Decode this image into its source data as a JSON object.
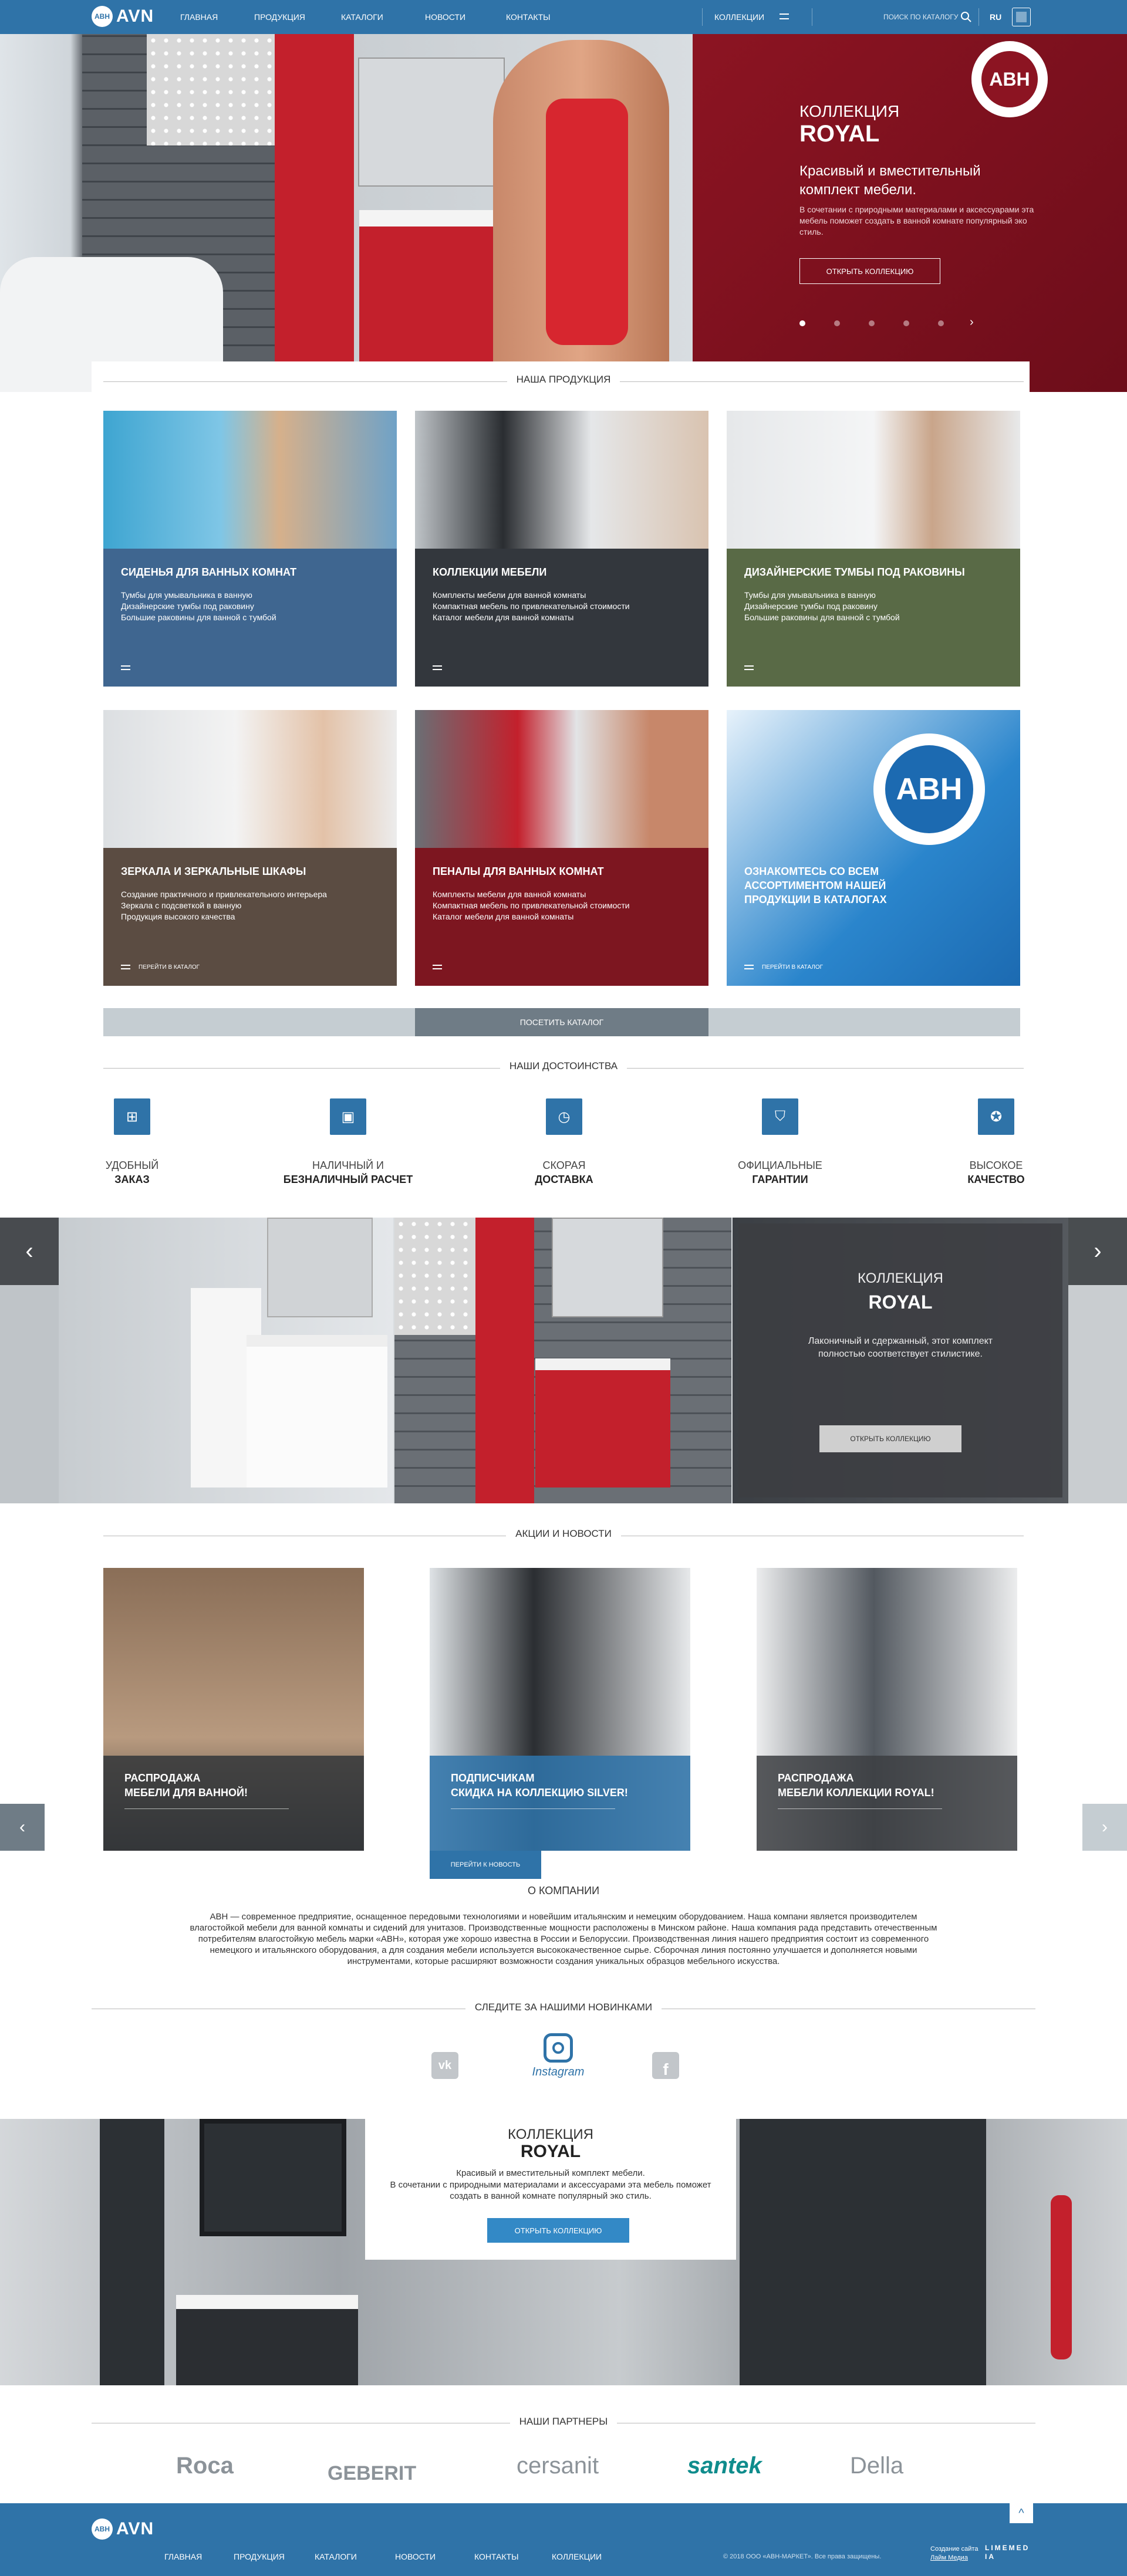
{
  "header": {
    "logo_badge": "АВН",
    "logo_text": "AVN",
    "nav": [
      "ГЛАВНАЯ",
      "ПРОДУКЦИЯ",
      "КАТАЛОГИ",
      "НОВОСТИ",
      "КОНТАКТЫ"
    ],
    "collections": "КОЛЛЕКЦИИ",
    "search_placeholder": "ПОИСК ПО КАТАЛОГУ",
    "lang": "RU"
  },
  "hero": {
    "badge": "АВН",
    "kicker": "КОЛЛЕКЦИЯ",
    "title": "ROYAL",
    "subtitle": "Красивый и вместительный комплект мебели.",
    "text": "В сочетании с природными материалами и аксессуарами эта мебель поможет создать в ванной комнате популярный эко стиль.",
    "button": "ОТКРЫТЬ КОЛЛЕКЦИЮ",
    "slides": 5,
    "active_slide": 1
  },
  "products": {
    "title": "НАША ПРОДУКЦИЯ",
    "cards": [
      {
        "title": "СИДЕНЬЯ ДЛЯ ВАННЫХ КОМНАТ",
        "lines": [
          "Тумбы для умывальника в ванную",
          "Дизайнерские тумбы под раковину",
          "Большие раковины для ванной с тумбой"
        ],
        "color": "#3f6690"
      },
      {
        "title": "КОЛЛЕКЦИИ МЕБЕЛИ",
        "lines": [
          "Комплекты мебели для ванной комнаты",
          "Компактная мебель по привлекательной стоимости",
          "Каталог мебели для ванной комнаты"
        ],
        "color": "#33373d"
      },
      {
        "title": "ДИЗАЙНЕРСКИЕ ТУМБЫ ПОД РАКОВИНЫ",
        "lines": [
          "Тумбы для умывальника в ванную",
          "Дизайнерские тумбы под раковину",
          "Большие раковины для ванной с тумбой"
        ],
        "color": "#596a46"
      },
      {
        "title": "ЗЕРКАЛА И ЗЕРКАЛЬНЫЕ ШКАФЫ",
        "lines": [
          "Создание практичного и привлекательного интерьера",
          "Зеркала с подсветкой в ванную",
          "Продукция высокого качества"
        ],
        "link": "ПЕРЕЙТИ В КАТАЛОГ",
        "color": "#5b4c42"
      },
      {
        "title": "ПЕНАЛЫ ДЛЯ ВАННЫХ КОМНАТ",
        "lines": [
          "Комплекты мебели для ванной комнаты",
          "Компактная мебель по привлекательной стоимости",
          "Каталог мебели для ванной комнаты"
        ],
        "color": "#7d1620"
      },
      {
        "title": "ОЗНАКОМТЕСЬ СО ВСЕМ АССОРТИМЕНТОМ НАШЕЙ ПРОДУКЦИИ В КАТАЛОГАХ",
        "lines": [],
        "link": "ПЕРЕЙТИ В КАТАЛОГ",
        "color": "#1c6ab1",
        "badge": "АВН"
      }
    ],
    "catalog_button": "ПОСЕТИТЬ КАТАЛОГ"
  },
  "advantages": {
    "title": "НАШИ ДОСТОИНСТВА",
    "items": [
      {
        "l1": "УДОБНЫЙ",
        "l2": "ЗАКАЗ",
        "icon": "cart-icon"
      },
      {
        "l1": "НАЛИЧНЫЙ И",
        "l2": "БЕЗНАЛИЧНЫЙ РАСЧЕТ",
        "icon": "wallet-icon"
      },
      {
        "l1": "СКОРАЯ",
        "l2": "ДОСТАВКА",
        "icon": "clock-icon"
      },
      {
        "l1": "ОФИЦИАЛЬНЫЕ",
        "l2": "ГАРАНТИИ",
        "icon": "shield-icon"
      },
      {
        "l1": "ВЫСОКОЕ",
        "l2": "КАЧЕСТВО",
        "icon": "medal-icon"
      }
    ]
  },
  "collection_slider": {
    "kicker": "КОЛЛЕКЦИЯ",
    "title": "ROYAL",
    "text": "Лаконичный и сдержанный, этот комплект полностью соответствует стилистике.",
    "button": "ОТКРЫТЬ КОЛЛЕКЦИЮ"
  },
  "news": {
    "title": "АКЦИИ И НОВОСТИ",
    "items": [
      {
        "l1": "РАСПРОДАЖА",
        "l2": "МЕБЕЛИ ДЛЯ ВАННОЙ!"
      },
      {
        "l1": "ПОДПИСЧИКАМ",
        "l2": "СКИДКА НА КОЛЛЕКЦИЮ SILVER!",
        "link": "ПЕРЕЙТИ К НОВОСТЬ"
      },
      {
        "l1": "РАСПРОДАЖА",
        "l2": "МЕБЕЛИ КОЛЛЕКЦИИ ROYAL!"
      }
    ]
  },
  "about": {
    "title": "О КОМПАНИИ",
    "text": "АВН — современное предприятие, оснащенное передовыми технологиями и новейшим итальянским и немецким оборудованием. Наша компани является производителем влагостойкой мебели для ванной комнаты и сидений для унитазов. Производственные мощности расположены в Минском районе. Наша компания рада представить отечественным потребителям влагостойкую мебель марки «АВН», которая уже хорошо известна в России и Белоруссии. Производственная линия нашего предприятия состоит из современного немецкого и итальянского оборудования, а для создания мебели используется высококачественное сырье. Сборочная линия постоянно улучшается и дополняется новыми инструментами, которые расширяют возможности создания уникальных образцов мебельного искусства."
  },
  "social": {
    "title": "СЛЕДИТЕ ЗА НАШИМИ НОВИНКАМИ",
    "instagram": "Instagram"
  },
  "promo": {
    "kicker": "КОЛЛЕКЦИЯ",
    "title": "ROYAL",
    "l1": "Красивый и вместительный комплект мебели.",
    "l2": "В сочетании с природными материалами и аксессуарами эта мебель поможет создать в ванной комнате популярный эко стиль.",
    "button": "ОТКРЫТЬ КОЛЛЕКЦИЮ"
  },
  "partners": {
    "title": "НАШИ ПАРТНЕРЫ",
    "items": [
      "Roca",
      "GEBERIT",
      "cersanit",
      "santek",
      "Della"
    ]
  },
  "footer": {
    "logo_badge": "АВН",
    "logo_text": "AVN",
    "nav": [
      "ГЛАВНАЯ",
      "ПРОДУКЦИЯ",
      "КАТАЛОГИ",
      "НОВОСТИ",
      "КОНТАКТЫ",
      "КОЛЛЕКЦИИ"
    ],
    "copyright": "© 2018 ООО «АВН-МАРКЕТ». Все права защищены.",
    "credit_label": "Создание сайта",
    "credit_link": "Лайм Медиа",
    "studio": "LIMEMEDIA"
  },
  "colors": {
    "primary": "#2f73a8",
    "red": "#8c1422",
    "gray": "#c5cdd2"
  }
}
